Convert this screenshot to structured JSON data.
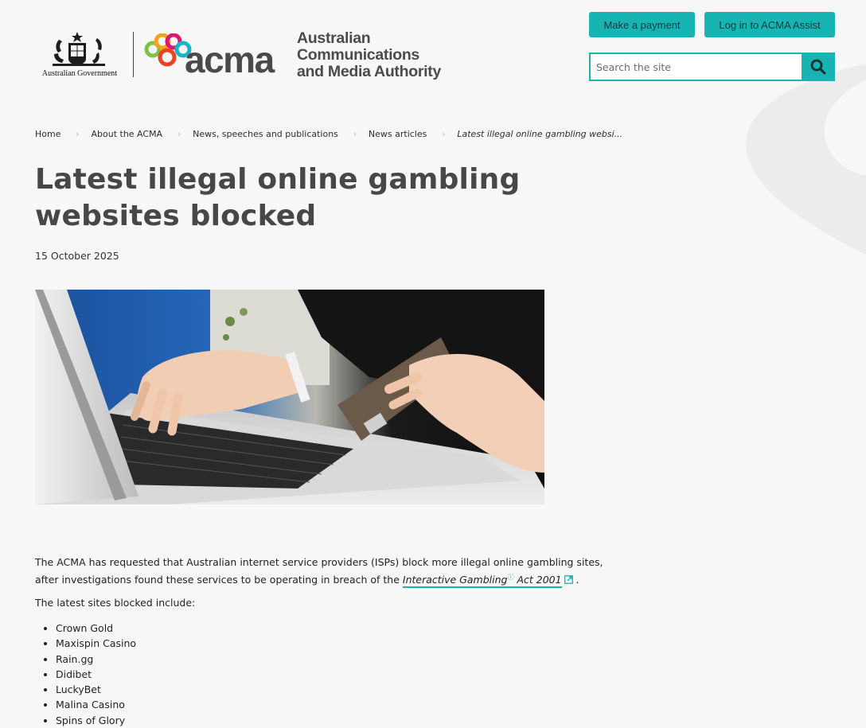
{
  "header": {
    "gov_label": "Australian Government",
    "logo_word": "acma",
    "authority_lines": [
      "Australian",
      "Communications",
      "and Media Authority"
    ],
    "buttons": {
      "payment": "Make a payment",
      "login": "Log in to ACMA Assist"
    },
    "search": {
      "placeholder": "Search the site",
      "value": ""
    }
  },
  "breadcrumb": {
    "items": [
      "Home",
      "About the ACMA",
      "News, speeches and publications",
      "News articles"
    ],
    "current": "Latest illegal online gambling websi..."
  },
  "article": {
    "title": "Latest illegal online gambling websites blocked",
    "date": "15 October 2025",
    "intro_before": "The ACMA has requested that Australian internet service providers (ISPs) block more illegal online gambling sites, after investigations found these services to be operating in breach of the ",
    "act_link": {
      "part1": "Interactive Gambling",
      "part2": " Act 2001"
    },
    "intro_after": " .",
    "lead": "The latest sites blocked include:",
    "sites": [
      "Crown Gold",
      "Maxispin Casino",
      "Rain.gg",
      "Didibet",
      "LuckyBet",
      "Malina Casino",
      "Spins of Glory"
    ]
  },
  "colors": {
    "accent": "#18b4b4",
    "title": "#474747",
    "background": "#f7f7f7"
  },
  "icons": {
    "search": "search-icon",
    "external": "external-link-icon",
    "separator": "chevron-right-icon"
  }
}
